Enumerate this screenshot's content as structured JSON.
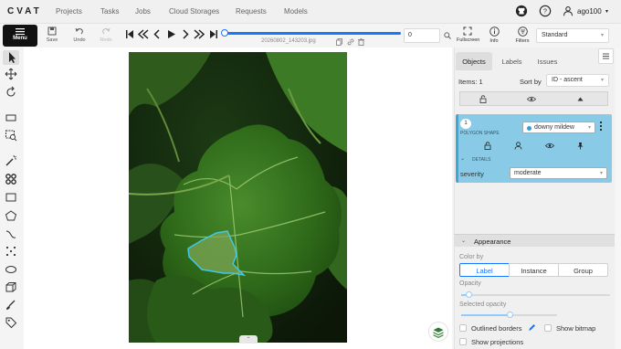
{
  "topnav": {
    "logo": "CVAT",
    "links": [
      "Projects",
      "Tasks",
      "Jobs",
      "Cloud Storages",
      "Requests",
      "Models"
    ],
    "username": "ago100"
  },
  "toolbar": {
    "menu_label": "Menu",
    "save_label": "Save",
    "undo_label": "Undo",
    "redo_label": "Redo",
    "filename": "20260802_143203.jpg",
    "frame_number": "0",
    "fullscreen_label": "Fullscreen",
    "info_label": "Info",
    "filters_label": "Filters",
    "workspace": "Standard",
    "progress_fraction": 0.0
  },
  "sidebar": {
    "tabs": [
      "Objects",
      "Labels",
      "Issues"
    ],
    "active_tab": "Objects",
    "items_count": "Items: 1",
    "sort_by_label": "Sort by",
    "sort_value": "ID - ascent",
    "object": {
      "id": "1",
      "shape": "POLYGON SHAPE",
      "label": "downy mildew",
      "label_color": "#2ea0d8",
      "details_label": "DETAILS",
      "attribute_name": "severity",
      "attribute_value": "moderate"
    },
    "appearance": {
      "title": "Appearance",
      "color_by_label": "Color by",
      "color_by_options": [
        "Label",
        "Instance",
        "Group"
      ],
      "color_by_selected": "Label",
      "opacity_label": "Opacity",
      "opacity_value": 0.05,
      "selected_opacity_label": "Selected opacity",
      "selected_opacity_value": 0.5,
      "outlined_borders_label": "Outlined borders",
      "show_bitmap_label": "Show bitmap",
      "show_projections_label": "Show projections"
    }
  },
  "colors": {
    "accent": "#1677ff",
    "object_card": "#89cbe6",
    "annotation_outline": "#3fc8e8"
  }
}
